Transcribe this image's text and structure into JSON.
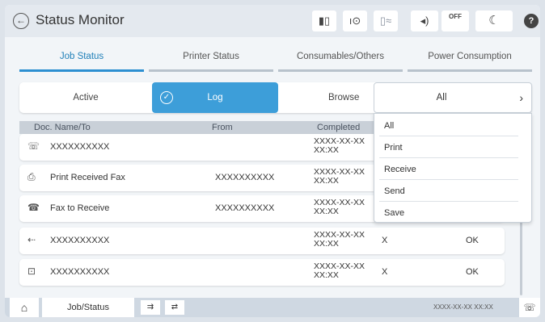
{
  "header": {
    "title": "Status Monitor",
    "back_icon": "←",
    "icons": [
      {
        "name": "ink-icon",
        "glyph": "▮▯"
      },
      {
        "name": "info-signal-icon",
        "glyph": "ı⊙"
      },
      {
        "name": "wifi-direct-icon",
        "glyph": "▯≈"
      },
      {
        "name": "sound-icon",
        "glyph": "◂)"
      },
      {
        "name": "quiet-mode-icon",
        "glyph": "OFF"
      },
      {
        "name": "sleep-mode-icon",
        "glyph": "☾"
      },
      {
        "name": "help-icon",
        "glyph": "?"
      }
    ]
  },
  "tabs": [
    {
      "label": "Job Status",
      "active": true
    },
    {
      "label": "Printer Status",
      "active": false
    },
    {
      "label": "Consumables/Others",
      "active": false
    },
    {
      "label": "Power Consumption",
      "active": false
    }
  ],
  "filter": {
    "active_label": "Active",
    "log_label": "Log",
    "browse_label": "Browse",
    "browse_value": "All",
    "chevron": "›"
  },
  "table": {
    "columns": [
      "Doc. Name/To",
      "From",
      "Completed"
    ],
    "rows": [
      {
        "icon": "fax-send-icon",
        "glyph": "☏",
        "name": "XXXXXXXXXX",
        "from": "",
        "completed_date": "XXXX-XX-XX",
        "completed_time": "XX:XX",
        "result": "",
        "status": ""
      },
      {
        "icon": "print-received-fax-icon",
        "glyph": "⎙",
        "name": "Print Received Fax",
        "from": "XXXXXXXXXX",
        "completed_date": "XXXX-XX-XX",
        "completed_time": "XX:XX",
        "result": "",
        "status": ""
      },
      {
        "icon": "fax-receive-icon",
        "glyph": "☎",
        "name": "Fax to Receive",
        "from": "XXXXXXXXXX",
        "completed_date": "XXXX-XX-XX",
        "completed_time": "XX:XX",
        "result": "",
        "status": ""
      },
      {
        "icon": "save-fax-icon",
        "glyph": "⇠",
        "name": "XXXXXXXXXX",
        "from": "",
        "completed_date": "XXXX-XX-XX",
        "completed_time": "XX:XX",
        "result": "X",
        "status": "OK"
      },
      {
        "icon": "fax-error-icon",
        "glyph": "⊡",
        "name": "XXXXXXXXXX",
        "from": "",
        "completed_date": "XXXX-XX-XX",
        "completed_time": "XX:XX",
        "result": "X",
        "status": "OK"
      }
    ]
  },
  "dropdown": {
    "options": [
      "All",
      "Print",
      "Receive",
      "Send",
      "Save"
    ]
  },
  "footer": {
    "home_icon": "⌂",
    "job_status_label": "Job/Status",
    "datetime": "XXXX-XX-XX XX:XX",
    "btn1_glyph": "⇉",
    "btn2_glyph": "⇄",
    "fax_glyph": "☏"
  }
}
